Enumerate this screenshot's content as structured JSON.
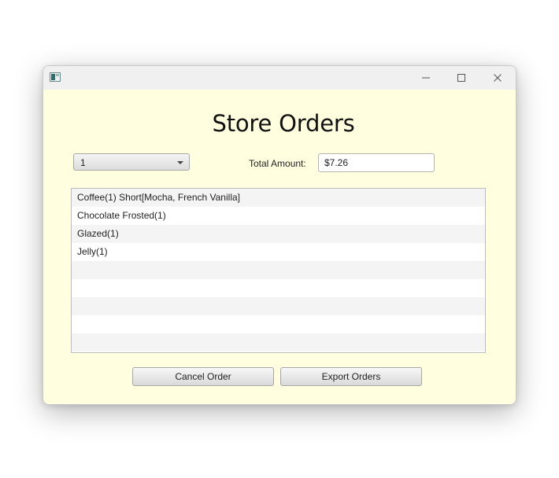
{
  "window": {
    "title": ""
  },
  "heading": "Store Orders",
  "order_select": {
    "selected": "1"
  },
  "total": {
    "label": "Total Amount:",
    "value": "$7.26"
  },
  "order_items": [
    "Coffee(1) Short[Mocha, French Vanilla]",
    "Chocolate Frosted(1)",
    "Glazed(1)",
    "Jelly(1)",
    "",
    "",
    "",
    "",
    ""
  ],
  "buttons": {
    "cancel": "Cancel Order",
    "export": "Export Orders"
  },
  "colors": {
    "background": "#ffffe0",
    "titlebar": "#f0f0f0"
  }
}
